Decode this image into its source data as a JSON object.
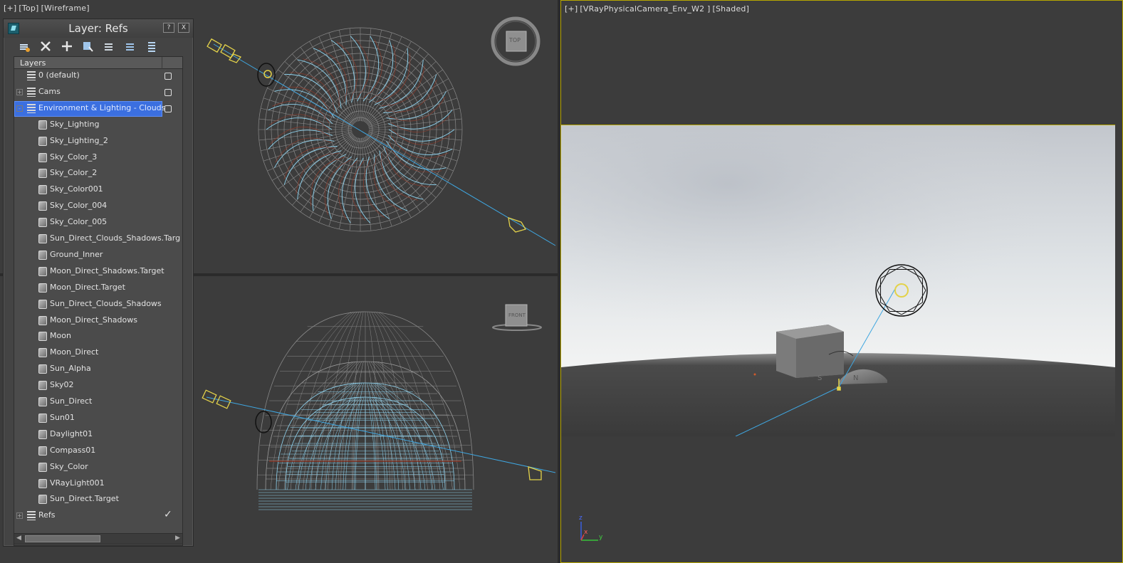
{
  "viewports": {
    "top": {
      "plus": "[+]",
      "view": "[Top]",
      "mode": "[Wireframe]",
      "cube_label": "TOP"
    },
    "front": {
      "cube_label": "FRONT"
    },
    "camera": {
      "plus": "[+]",
      "view": "[VRayPhysicalCamera_Env_W2 ]",
      "mode": "[Shaded]",
      "axis_labels": {
        "z": "z",
        "x": "x",
        "y": "y"
      },
      "compass_labels": {
        "s": "S",
        "n": "N"
      }
    }
  },
  "layer_panel": {
    "title": "Layer: Refs",
    "help_button": "?",
    "close_button": "X",
    "toolbar_icons": [
      "new-layer-icon",
      "delete-layer-icon",
      "add-to-layer-icon",
      "select-objects-icon",
      "select-layer-icon",
      "set-current-icon",
      "hide-all-icon"
    ],
    "column_header": "Layers",
    "rows": [
      {
        "label": "0 (default)",
        "kind": "layer",
        "expander": "",
        "state": "box"
      },
      {
        "label": "Cams",
        "kind": "layer",
        "expander": "+",
        "state": "box"
      },
      {
        "label": "Environment & Lighting - Clouds",
        "kind": "layer",
        "expander": "-",
        "state": "box",
        "selected": true
      },
      {
        "label": "Sky_Lighting",
        "kind": "object"
      },
      {
        "label": "Sky_Lighting_2",
        "kind": "object"
      },
      {
        "label": "Sky_Color_3",
        "kind": "object"
      },
      {
        "label": "Sky_Color_2",
        "kind": "object"
      },
      {
        "label": "Sky_Color001",
        "kind": "object"
      },
      {
        "label": "Sky_Color_004",
        "kind": "object"
      },
      {
        "label": "Sky_Color_005",
        "kind": "object"
      },
      {
        "label": "Sun_Direct_Clouds_Shadows.Targ",
        "kind": "object"
      },
      {
        "label": "Ground_Inner",
        "kind": "object"
      },
      {
        "label": "Moon_Direct_Shadows.Target",
        "kind": "object"
      },
      {
        "label": "Moon_Direct.Target",
        "kind": "object"
      },
      {
        "label": "Sun_Direct_Clouds_Shadows",
        "kind": "object"
      },
      {
        "label": "Moon_Direct_Shadows",
        "kind": "object"
      },
      {
        "label": "Moon",
        "kind": "object"
      },
      {
        "label": "Moon_Direct",
        "kind": "object"
      },
      {
        "label": "Sun_Alpha",
        "kind": "object"
      },
      {
        "label": "Sky02",
        "kind": "object"
      },
      {
        "label": "Sun_Direct",
        "kind": "object"
      },
      {
        "label": "Sun01",
        "kind": "object"
      },
      {
        "label": "Daylight01",
        "kind": "object"
      },
      {
        "label": "Compass01",
        "kind": "object"
      },
      {
        "label": "Sky_Color",
        "kind": "object"
      },
      {
        "label": "VRayLight001",
        "kind": "object"
      },
      {
        "label": "Sun_Direct.Target",
        "kind": "object"
      },
      {
        "label": "Refs",
        "kind": "layer",
        "expander": "+",
        "state": "check"
      }
    ]
  },
  "colors": {
    "selection": "#3b6fe0",
    "active_viewport_border": "#b6a600",
    "wire_grey": "#9a9a9a",
    "wire_cyan": "#8fd3ef",
    "wire_red": "#8a3b2c",
    "light_yellow": "#e3d24a",
    "light_blue_line": "#3fa6e0"
  }
}
